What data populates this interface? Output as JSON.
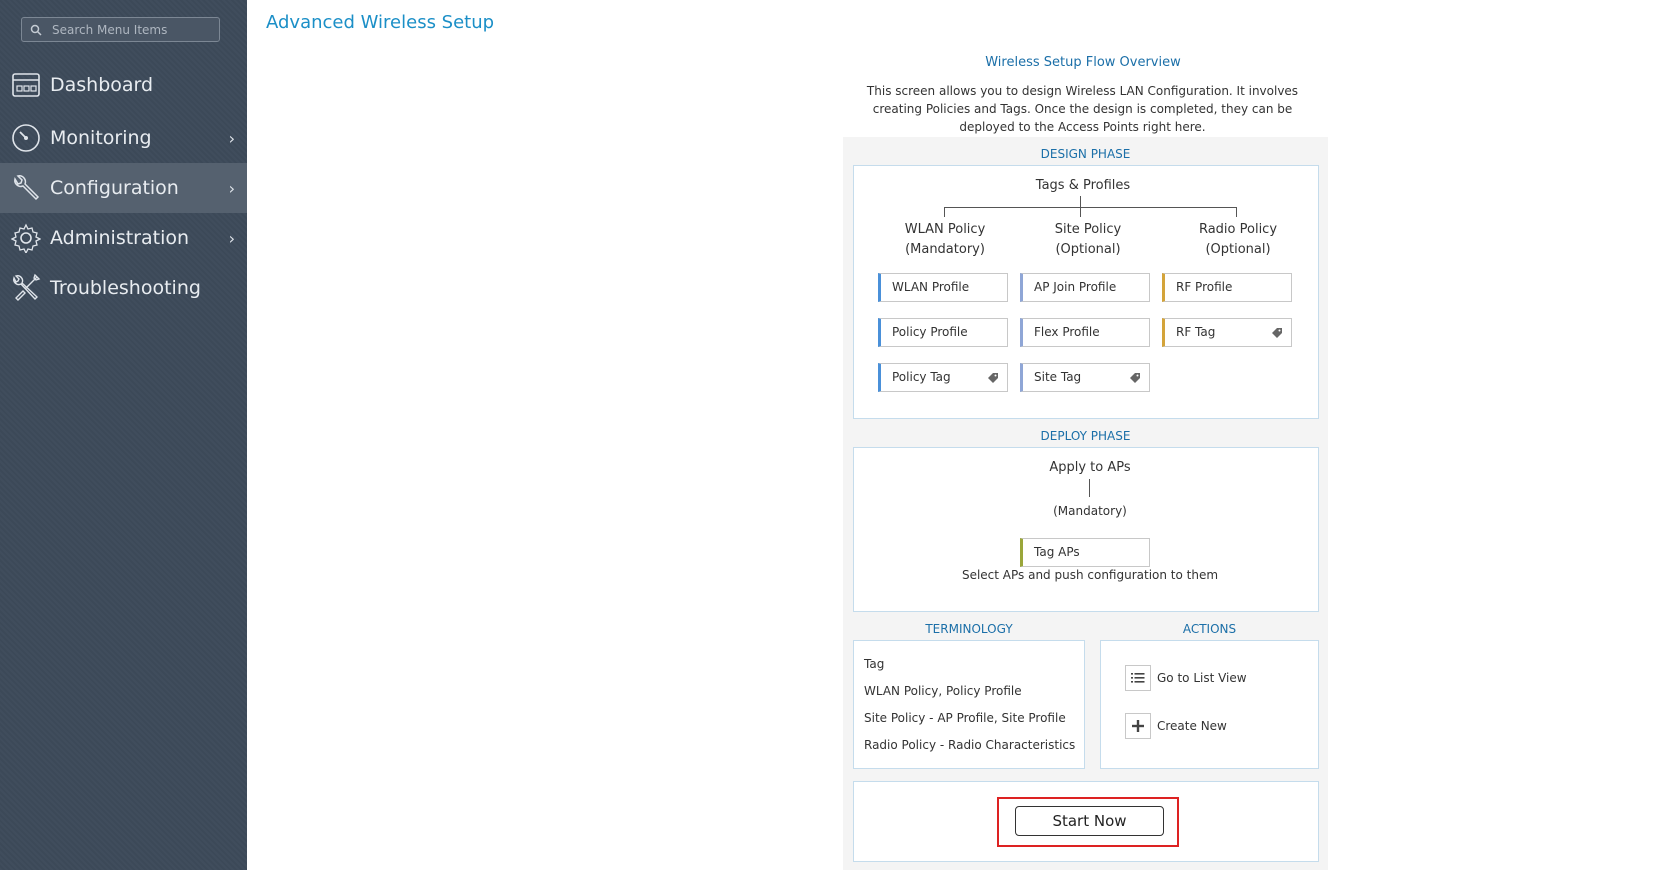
{
  "sidebar": {
    "search_placeholder": "Search Menu Items",
    "items": [
      {
        "label": "Dashboard",
        "icon": "dashboard-icon",
        "chevron": false
      },
      {
        "label": "Monitoring",
        "icon": "gauge-icon",
        "chevron": true
      },
      {
        "label": "Configuration",
        "icon": "wrench-icon",
        "chevron": true,
        "active": true
      },
      {
        "label": "Administration",
        "icon": "gear-icon",
        "chevron": true
      },
      {
        "label": "Troubleshooting",
        "icon": "tools-icon",
        "chevron": false
      }
    ]
  },
  "main": {
    "title": "Advanced Wireless Setup",
    "overview_title": "Wireless Setup Flow Overview",
    "overview_desc": "This screen allows you to design Wireless LAN Configuration. It involves creating Policies and Tags. Once the design is completed, they can be deployed to the Access Points right here."
  },
  "design": {
    "label": "DESIGN PHASE",
    "root": "Tags & Profiles",
    "columns": [
      {
        "name": "WLAN Policy",
        "note": "(Mandatory)"
      },
      {
        "name": "Site Policy",
        "note": "(Optional)"
      },
      {
        "name": "Radio Policy",
        "note": "(Optional)"
      }
    ],
    "profiles": {
      "wlan_profile": "WLAN Profile",
      "policy_profile": "Policy Profile",
      "policy_tag": "Policy Tag",
      "ap_join_profile": "AP Join Profile",
      "flex_profile": "Flex Profile",
      "site_tag": "Site Tag",
      "rf_profile": "RF Profile",
      "rf_tag": "RF Tag"
    }
  },
  "deploy": {
    "label": "DEPLOY PHASE",
    "root": "Apply to APs",
    "note": "(Mandatory)",
    "tag_aps": "Tag APs",
    "desc": "Select APs and push configuration to them"
  },
  "terminology": {
    "label": "TERMINOLOGY",
    "items": [
      "Tag",
      "WLAN Policy, Policy Profile",
      "Site Policy - AP Profile, Site Profile",
      "Radio Policy - Radio Characteristics"
    ]
  },
  "actions": {
    "label": "ACTIONS",
    "list_view": "Go to List View",
    "create_new": "Create New"
  },
  "start_button": "Start Now",
  "colors": {
    "sidebar_bg": "#3d4a5a",
    "accent": "#1b8fc7",
    "wlan_border": "#4a90d9",
    "site_border": "#8fa6d6",
    "radio_border": "#d4a43a",
    "deploy_border": "#9aa63a",
    "highlight": "#dd2222"
  }
}
